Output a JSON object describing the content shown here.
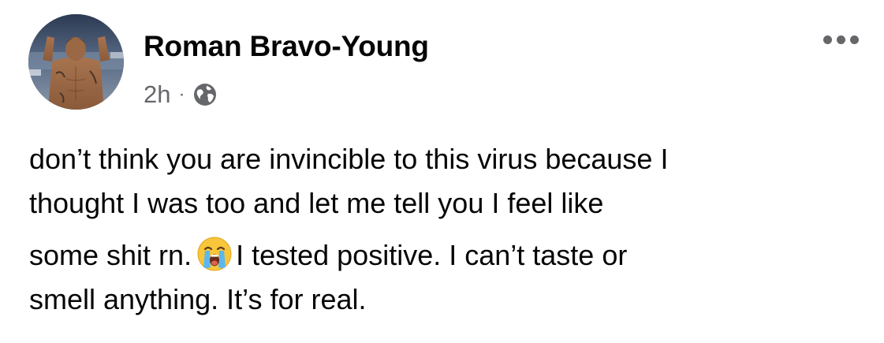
{
  "post": {
    "author": {
      "name": "Roman Bravo-Young",
      "avatar_icon": "profile-photo"
    },
    "timestamp": "2h",
    "separator": "·",
    "audience_icon": "globe-icon",
    "more_icon": "more-horizontal-icon",
    "text_lines": [
      "don’t think you are invincible to this virus because I",
      "thought I was too and let me tell you I feel like",
      "some shit rn.",
      "I tested positive. I can’t taste or",
      "smell anything. It’s for real."
    ],
    "emoji": "loudly-crying-face-emoji"
  },
  "colors": {
    "text": "#050505",
    "secondary_text": "#65676b",
    "background": "#ffffff"
  }
}
